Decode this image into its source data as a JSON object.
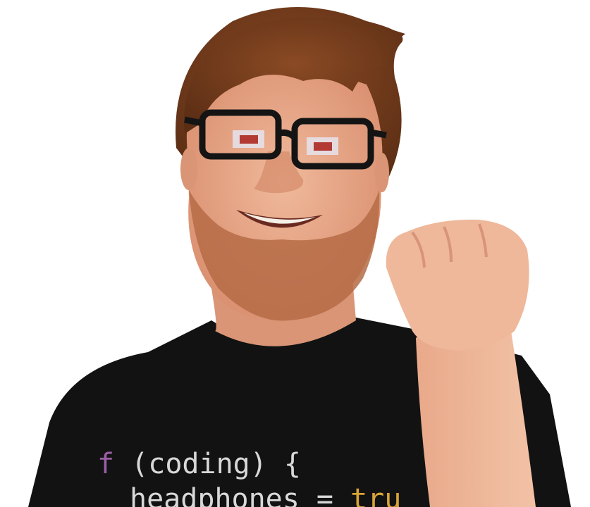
{
  "photo": {
    "subject": "smiling-man-with-glasses-raised-fist",
    "background_color": "#ffffff",
    "colors": {
      "hair": "#6e3a1c",
      "skin": "#e8a98a",
      "beard": "#b56b45",
      "shirt": "#121212",
      "glasses_frame": "#141414"
    }
  },
  "shirt_text": {
    "line1": {
      "keyword": "f",
      "rest": " (coding) {"
    },
    "line2": {
      "name": "headphones",
      "op": " = ",
      "value": "tru"
    },
    "colors": {
      "keyword": "#9b5ea6",
      "text": "#d8d8d8",
      "value": "#d9a437"
    }
  }
}
